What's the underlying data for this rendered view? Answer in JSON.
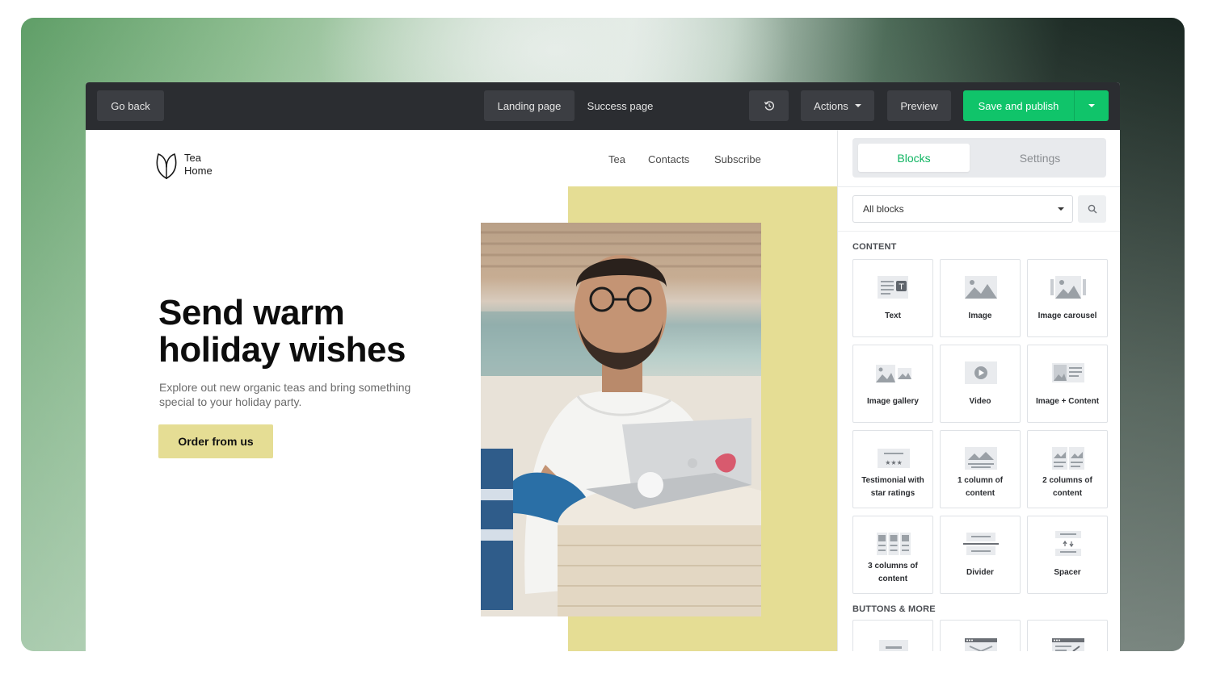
{
  "toolbar": {
    "go_back": "Go back",
    "page_tabs": [
      "Landing page",
      "Success page"
    ],
    "history_icon": "history-icon",
    "actions": "Actions",
    "preview": "Preview",
    "save_publish": "Save and publish",
    "colors": {
      "bar": "#2b2d31",
      "button": "#3c3e43",
      "publish": "#10c46a"
    }
  },
  "landing": {
    "logo": {
      "line1": "Tea",
      "line2": "Home",
      "icon": "leaf-icon"
    },
    "nav": [
      "Tea",
      "Contacts",
      "Subscribe"
    ],
    "headline_line1": "Send warm",
    "headline_line2": "holiday wishes",
    "subcopy": "Explore out new organic teas and bring something special to your holiday party.",
    "cta": "Order from us",
    "accent_color": "#e5dd94"
  },
  "panel": {
    "tabs": {
      "active": "Blocks",
      "inactive": "Settings"
    },
    "select_value": "All blocks",
    "sections": {
      "content": "CONTENT",
      "buttons": "BUTTONS & MORE"
    },
    "content_blocks": [
      {
        "label": "Text",
        "icon": "text-block-icon"
      },
      {
        "label": "Image",
        "icon": "image-icon"
      },
      {
        "label": "Image carousel",
        "icon": "image-carousel-icon"
      },
      {
        "label": "Image gallery",
        "icon": "image-gallery-icon"
      },
      {
        "label": "Video",
        "icon": "video-icon"
      },
      {
        "label": "Image + Content",
        "icon": "image-content-icon"
      },
      {
        "label1": "Testimonial with",
        "label2": "star ratings",
        "icon": "testimonial-icon"
      },
      {
        "label1": "1 column of",
        "label2": "content",
        "icon": "one-column-icon"
      },
      {
        "label1": "2 columns of",
        "label2": "content",
        "icon": "two-columns-icon"
      },
      {
        "label1": "3 columns of",
        "label2": "content",
        "icon": "three-columns-icon"
      },
      {
        "label": "Divider",
        "icon": "divider-icon"
      },
      {
        "label": "Spacer",
        "icon": "spacer-icon"
      }
    ],
    "button_blocks": [
      {
        "icon": "button-block-icon"
      },
      {
        "icon": "navbar-block-icon"
      },
      {
        "icon": "social-block-icon"
      }
    ],
    "accent_color": "#10b562"
  }
}
